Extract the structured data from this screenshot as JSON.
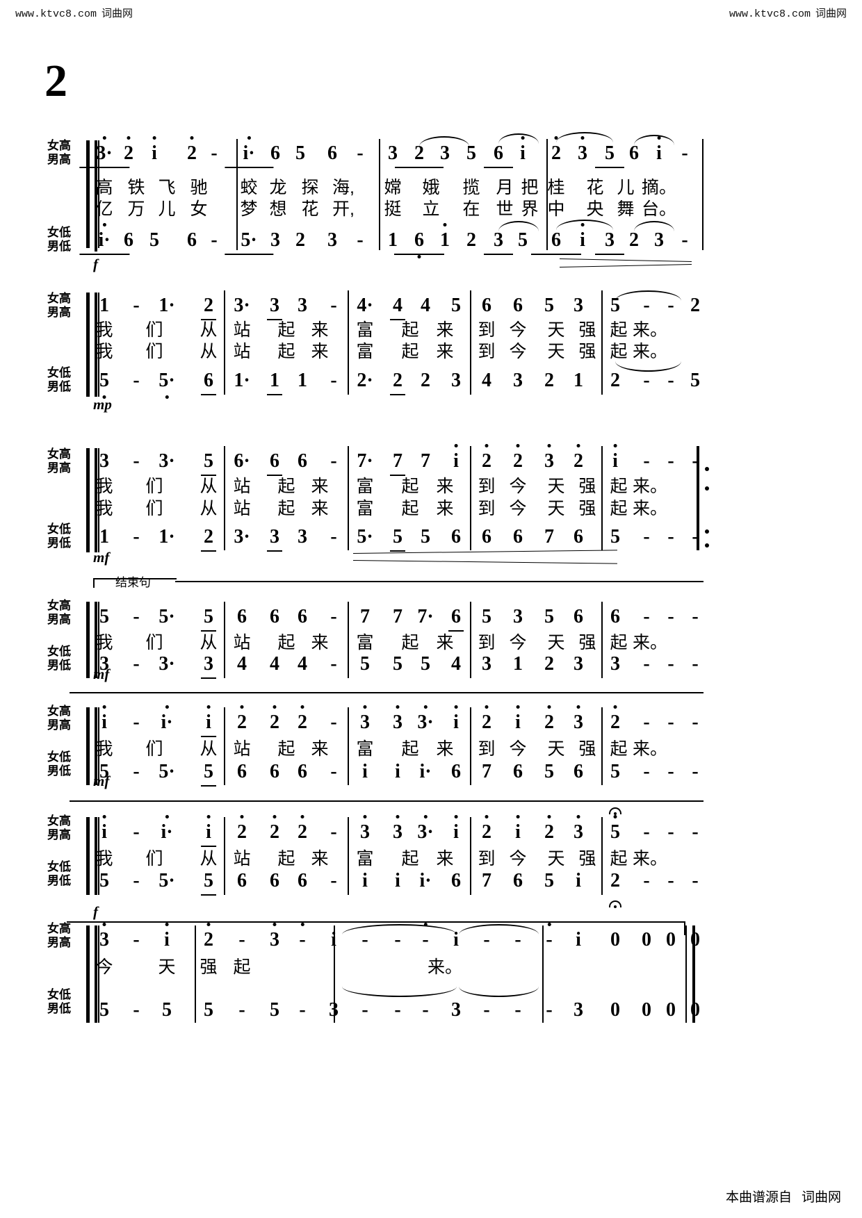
{
  "watermark": {
    "url": "www.ktvc8.com",
    "site": "词曲网"
  },
  "page_number": "2",
  "footer": {
    "source": "本曲谱源自",
    "site": "词曲网"
  },
  "voice_labels": {
    "upper_line1": "女高",
    "upper_line2": "男高",
    "lower_line1": "女低",
    "lower_line2": "男低"
  },
  "markers": {
    "ending_phrase": "结束句"
  },
  "dynamics": {
    "f": "f",
    "mp": "mp",
    "mf": "mf"
  },
  "systems": [
    {
      "id": "system-1",
      "upper_notes": [
        "3·",
        "2",
        "i",
        "2",
        "-",
        "i·",
        "6",
        "5",
        "6",
        "-",
        "3",
        "2",
        "3",
        "5",
        "6",
        "i",
        "2",
        "3",
        "5",
        "6",
        "i",
        "-"
      ],
      "lower_notes": [
        "i·",
        "6",
        "5",
        "6",
        "-",
        "5·",
        "3",
        "2",
        "3",
        "-",
        "1",
        "6",
        "1",
        "2",
        "3",
        "5",
        "6",
        "i",
        "3",
        "2",
        "3",
        "-"
      ],
      "lyrics_line1": [
        "高",
        "铁",
        "飞",
        "驰",
        "蛟",
        "龙",
        "探",
        "海,",
        "嫦",
        "娥",
        "揽",
        "月",
        "把",
        "桂",
        "花",
        "儿",
        "摘。"
      ],
      "lyrics_line2": [
        "亿",
        "万",
        "儿",
        "女",
        "梦",
        "想",
        "花",
        "开,",
        "挺",
        "立",
        "在",
        "世",
        "界",
        "中",
        "央",
        "舞",
        "台。"
      ],
      "dynamic": "f"
    },
    {
      "id": "system-2",
      "upper_notes": [
        "1",
        "-",
        "1·",
        "2",
        "3·",
        "3",
        "3",
        "-",
        "4·",
        "4",
        "4",
        "5",
        "6",
        "6",
        "5",
        "3",
        "5",
        "-",
        "-",
        "2"
      ],
      "lower_notes": [
        "5",
        "-",
        "5·",
        "6",
        "1·",
        "1",
        "1",
        "-",
        "2·",
        "2",
        "2",
        "3",
        "4",
        "3",
        "2",
        "1",
        "2",
        "-",
        "-",
        "5"
      ],
      "lyrics_line1": [
        "我",
        "们",
        "从",
        "站",
        "起",
        "来",
        "富",
        "起",
        "来",
        "到",
        "今",
        "天",
        "强",
        "起",
        "来。"
      ],
      "lyrics_line2": [
        "我",
        "们",
        "从",
        "站",
        "起",
        "来",
        "富",
        "起",
        "来",
        "到",
        "今",
        "天",
        "强",
        "起",
        "来。"
      ],
      "dynamic": "mp"
    },
    {
      "id": "system-3",
      "upper_notes": [
        "3",
        "-",
        "3·",
        "5",
        "6·",
        "6",
        "6",
        "-",
        "7·",
        "7",
        "7",
        "i",
        "2",
        "2",
        "3",
        "2",
        "i",
        "-",
        "-",
        "-"
      ],
      "lower_notes": [
        "1",
        "-",
        "1·",
        "2",
        "3·",
        "3",
        "3",
        "-",
        "5·",
        "5",
        "5",
        "6",
        "6",
        "6",
        "7",
        "6",
        "5",
        "-",
        "-",
        "-"
      ],
      "lyrics_line1": [
        "我",
        "们",
        "从",
        "站",
        "起",
        "来",
        "富",
        "起",
        "来",
        "到",
        "今",
        "天",
        "强",
        "起",
        "来。"
      ],
      "lyrics_line2": [
        "我",
        "们",
        "从",
        "站",
        "起",
        "来",
        "富",
        "起",
        "来",
        "到",
        "今",
        "天",
        "强",
        "起",
        "来。"
      ],
      "dynamic": "mf"
    },
    {
      "id": "system-4",
      "upper_notes": [
        "5",
        "-",
        "5·",
        "5",
        "6",
        "6",
        "6",
        "-",
        "7",
        "7",
        "7·",
        "6",
        "5",
        "3",
        "5",
        "6",
        "6",
        "-",
        "-",
        "-"
      ],
      "lower_notes": [
        "3",
        "-",
        "3·",
        "3",
        "4",
        "4",
        "4",
        "-",
        "5",
        "5",
        "5",
        "4",
        "3",
        "1",
        "2",
        "3",
        "3",
        "-",
        "-",
        "-"
      ],
      "lyrics_line1": [
        "我",
        "们",
        "从",
        "站",
        "起",
        "来",
        "富",
        "起",
        "来",
        "到",
        "今",
        "天",
        "强",
        "起",
        "来。"
      ],
      "dynamic": "mf"
    },
    {
      "id": "system-5",
      "upper_notes": [
        "i",
        "-",
        "i·",
        "i",
        "2",
        "2",
        "2",
        "-",
        "3",
        "3",
        "3·",
        "i",
        "2",
        "i",
        "2",
        "3",
        "2",
        "-",
        "-",
        "-"
      ],
      "lower_notes": [
        "5",
        "-",
        "5·",
        "5",
        "6",
        "6",
        "6",
        "-",
        "i",
        "i",
        "i·",
        "6",
        "7",
        "6",
        "5",
        "6",
        "5",
        "-",
        "-",
        "-"
      ],
      "lyrics_line1": [
        "我",
        "们",
        "从",
        "站",
        "起",
        "来",
        "富",
        "起",
        "来",
        "到",
        "今",
        "天",
        "强",
        "起",
        "来。"
      ],
      "dynamic": "mf"
    },
    {
      "id": "system-6",
      "upper_notes": [
        "i",
        "-",
        "i·",
        "i",
        "2",
        "2",
        "2",
        "-",
        "3",
        "3",
        "3·",
        "i",
        "2",
        "i",
        "2",
        "3",
        "5",
        "-",
        "-",
        "-"
      ],
      "lower_notes": [
        "5",
        "-",
        "5·",
        "5",
        "6",
        "6",
        "6",
        "-",
        "i",
        "i",
        "i·",
        "6",
        "7",
        "6",
        "5",
        "i",
        "2",
        "-",
        "-",
        "-"
      ],
      "lyrics_line1": [
        "我",
        "们",
        "从",
        "站",
        "起",
        "来",
        "富",
        "起",
        "来",
        "到",
        "今",
        "天",
        "强",
        "起",
        "来。"
      ],
      "dynamic": "f"
    },
    {
      "id": "system-7",
      "upper_notes": [
        "3",
        "-",
        "i",
        "2",
        "-",
        "3",
        "-",
        "i",
        "-",
        "-",
        "-",
        "i",
        "-",
        "-",
        "-",
        "i",
        "0",
        "0",
        "0",
        "0"
      ],
      "lower_notes": [
        "5",
        "-",
        "5",
        "5",
        "-",
        "5",
        "-",
        "3",
        "-",
        "-",
        "-",
        "3",
        "-",
        "-",
        "-",
        "3",
        "0",
        "0",
        "0",
        "0"
      ],
      "lyrics_line1": [
        "今",
        "天",
        "强",
        "起",
        "来。"
      ],
      "dynamic": ""
    }
  ]
}
